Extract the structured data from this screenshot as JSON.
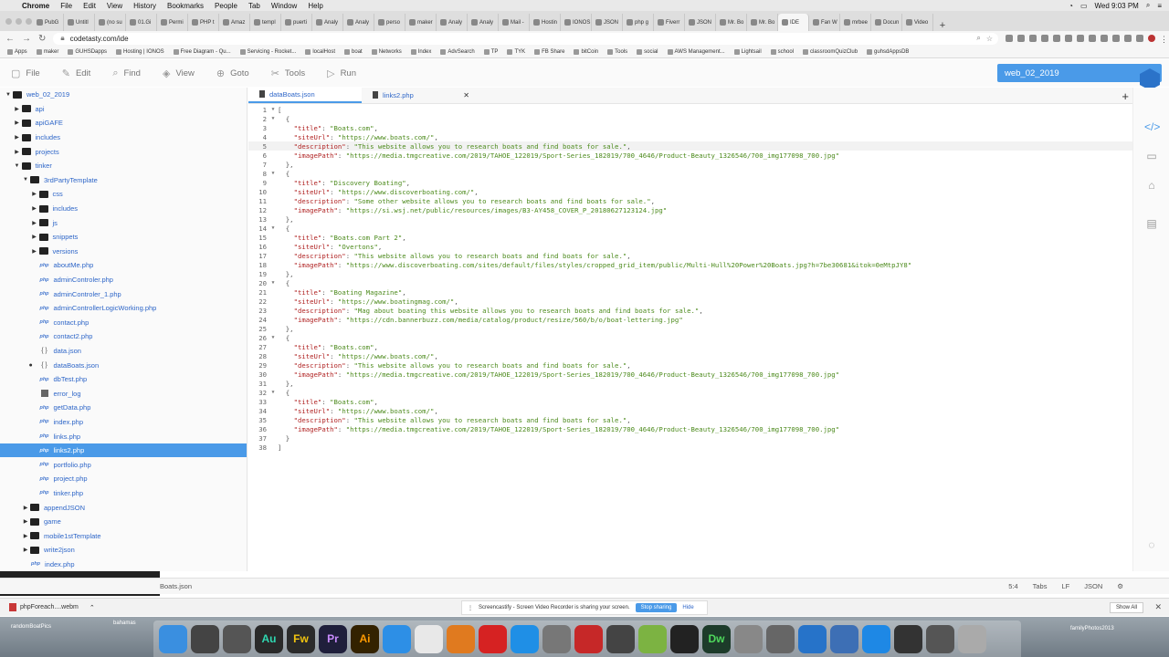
{
  "menubar": {
    "apple": "",
    "items": [
      "Chrome",
      "File",
      "Edit",
      "View",
      "History",
      "Bookmarks",
      "People",
      "Tab",
      "Window",
      "Help"
    ],
    "clock": "Wed 9:03 PM"
  },
  "browser_tabs": [
    "PubG",
    "Untitl",
    "(no su",
    "01.Gi",
    "Permi",
    "PHP t",
    "Amaz",
    "templ",
    "puerti",
    "Analy",
    "Analy",
    "perso",
    "maker",
    "Analy",
    "Analy",
    "Mail -",
    "Hostin",
    "IONOS",
    "JSON",
    "php g",
    "Fiverr",
    "JSON",
    "Mr. Bo",
    "Mr. Bo",
    "IDE",
    "Fan W",
    "mrbee",
    "Docun",
    "Video"
  ],
  "address": {
    "url": "codetasty.com/ide"
  },
  "bookmarks": [
    "Apps",
    "maker",
    "GUHSDapps",
    "Hosting | IONOS",
    "Free Diagram - Qu...",
    "Servicing - Rocket...",
    "localHost",
    "boat",
    "Networks",
    "Index",
    "AdvSearch",
    "TP",
    "TYK",
    "FB Share",
    "bitCoin",
    "Tools",
    "social",
    "AWS Management...",
    "Lightsail",
    "school",
    "classroomQuizClub",
    "guhsdAppsDB"
  ],
  "toolbar": {
    "file": "File",
    "edit": "Edit",
    "find": "Find",
    "view": "View",
    "goto": "Goto",
    "tools": "Tools",
    "run": "Run",
    "project": "web_02_2019"
  },
  "tree": [
    {
      "label": "web_02_2019",
      "depth": 0,
      "type": "folder",
      "open": true
    },
    {
      "label": "api",
      "depth": 1,
      "type": "folder"
    },
    {
      "label": "apiGAFE",
      "depth": 1,
      "type": "folder"
    },
    {
      "label": "includes",
      "depth": 1,
      "type": "folder"
    },
    {
      "label": "projects",
      "depth": 1,
      "type": "folder"
    },
    {
      "label": "tinker",
      "depth": 1,
      "type": "folder",
      "open": true
    },
    {
      "label": "3rdPartyTemplate",
      "depth": 2,
      "type": "folder",
      "open": true
    },
    {
      "label": "css",
      "depth": 3,
      "type": "folder"
    },
    {
      "label": "includes",
      "depth": 3,
      "type": "folder"
    },
    {
      "label": "js",
      "depth": 3,
      "type": "folder"
    },
    {
      "label": "snippets",
      "depth": 3,
      "type": "folder"
    },
    {
      "label": "versions",
      "depth": 3,
      "type": "folder"
    },
    {
      "label": "aboutMe.php",
      "depth": 3,
      "type": "php"
    },
    {
      "label": "adminControler.php",
      "depth": 3,
      "type": "php"
    },
    {
      "label": "adminControler_1.php",
      "depth": 3,
      "type": "php"
    },
    {
      "label": "adminControllerLogicWorking.php",
      "depth": 3,
      "type": "php"
    },
    {
      "label": "contact.php",
      "depth": 3,
      "type": "php"
    },
    {
      "label": "contact2.php",
      "depth": 3,
      "type": "php"
    },
    {
      "label": "data.json",
      "depth": 3,
      "type": "json"
    },
    {
      "label": "dataBoats.json",
      "depth": 3,
      "type": "json",
      "modified": true
    },
    {
      "label": "dbTest.php",
      "depth": 3,
      "type": "php"
    },
    {
      "label": "error_log",
      "depth": 3,
      "type": "log"
    },
    {
      "label": "getData.php",
      "depth": 3,
      "type": "php"
    },
    {
      "label": "index.php",
      "depth": 3,
      "type": "php"
    },
    {
      "label": "links.php",
      "depth": 3,
      "type": "php"
    },
    {
      "label": "links2.php",
      "depth": 3,
      "type": "php",
      "selected": true
    },
    {
      "label": "portfolio.php",
      "depth": 3,
      "type": "php"
    },
    {
      "label": "project.php",
      "depth": 3,
      "type": "php"
    },
    {
      "label": "tinker.php",
      "depth": 3,
      "type": "php"
    },
    {
      "label": "appendJSON",
      "depth": 2,
      "type": "folder"
    },
    {
      "label": "game",
      "depth": 2,
      "type": "folder"
    },
    {
      "label": "mobile1stTemplate",
      "depth": 2,
      "type": "folder"
    },
    {
      "label": "write2json",
      "depth": 2,
      "type": "folder"
    },
    {
      "label": "index.php",
      "depth": 2,
      "type": "php"
    }
  ],
  "php_badge": "php",
  "json_badge": "{ }",
  "editor_tabs": [
    {
      "label": "dataBoats.json",
      "active": true
    },
    {
      "label": "links2.php",
      "active": false
    }
  ],
  "code_lines": [
    "[",
    "  {",
    "    \"title\": \"Boats.com\",",
    "    \"siteUrl\": \"https://www.boats.com/\",",
    "    \"description\": \"This website allows you to research boats and find boats for sale.\",",
    "    \"imagePath\": \"https://media.tmgcreative.com/2019/TAHOE_122019/Sport-Series_182019/700_4646/Product-Beauty_1326546/700_img177098_700.jpg\"",
    "  },",
    "  {",
    "    \"title\": \"Discovery Boating\",",
    "    \"siteUrl\": \"https://www.discoverboating.com/\",",
    "    \"description\": \"Some other website allows you to research boats and find boats for sale.\",",
    "    \"imagePath\": \"https://si.wsj.net/public/resources/images/B3-AY458_COVER_P_20180627123124.jpg\"",
    "  },",
    "  {",
    "    \"title\": \"Boats.com Part 2\",",
    "    \"siteUrl\": \"Overtons\",",
    "    \"description\": \"This website allows you to research boats and find boats for sale.\",",
    "    \"imagePath\": \"https://www.discoverboating.com/sites/default/files/styles/cropped_grid_item/public/Multi-Hull%20Power%20Boats.jpg?h=7be30681&itok=0eMtpJY8\"",
    "  },",
    "  {",
    "    \"title\": \"Boating Magazine\",",
    "    \"siteUrl\": \"https://www.boatingmag.com/\",",
    "    \"description\": \"Mag about boating this website allows you to research boats and find boats for sale.\",",
    "    \"imagePath\": \"https://cdn.bannerbuzz.com/media/catalog/product/resize/560/b/o/boat-lettering.jpg\"",
    "  },",
    "  {",
    "    \"title\": \"Boats.com\",",
    "    \"siteUrl\": \"https://www.boats.com/\",",
    "    \"description\": \"This website allows you to research boats and find boats for sale.\",",
    "    \"imagePath\": \"https://media.tmgcreative.com/2019/TAHOE_122019/Sport-Series_182019/700_4646/Product-Beauty_1326546/700_img177098_700.jpg\"",
    "  },",
    "  {",
    "    \"title\": \"Boats.com\",",
    "    \"siteUrl\": \"https://www.boats.com/\",",
    "    \"description\": \"This website allows you to research boats and find boats for sale.\",",
    "    \"imagePath\": \"https://media.tmgcreative.com/2019/TAHOE_122019/Sport-Series_182019/700_4646/Product-Beauty_1326546/700_img177098_700.jpg\"",
    "  }",
    "]"
  ],
  "status": {
    "filename": "Boats.json",
    "cursor": "5:4",
    "tabs": "Tabs",
    "eol": "LF",
    "mode": "JSON"
  },
  "downloads": {
    "file": "phpForeach....webm",
    "share_text": "Screencastify - Screen Video Recorder is sharing your screen.",
    "stop": "Stop sharing",
    "hide": "Hide",
    "show_all": "Show All"
  },
  "desktop": {
    "left_label": "randomBoatPics",
    "left_label2": "bahamas",
    "right_label": "familyPhotos2013"
  },
  "dock_apps": [
    "Finder",
    "Siri",
    "Launchpad",
    "Au",
    "Fw",
    "Pr",
    "Ai",
    "Safari",
    "Chrome",
    "Firefox",
    "Opera",
    "App Store",
    "Preferences",
    "Acrobat",
    "Calculator",
    "Android",
    "Terminal",
    "Dw",
    "Sequel",
    "Help",
    "VS Code",
    "Box",
    "TeamViewer",
    "Activity",
    "Preview",
    "Trash"
  ],
  "colors": {
    "accent": "#4a9ae8",
    "key": "#b02222",
    "string": "#4c8a1c"
  }
}
